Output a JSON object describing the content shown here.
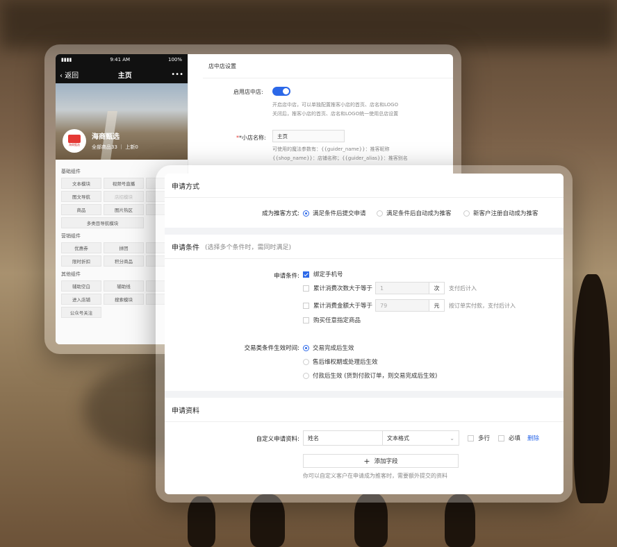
{
  "phone": {
    "signal": "▮▮▮▮",
    "time": "9:41 AM",
    "battery": "100%",
    "back_label": "返回",
    "title": "主页",
    "more": "•••",
    "shop_name": "海商甄选",
    "shop_logo_text": "海商甄选",
    "shop_stats": "全部商品33 ｜ 上新0"
  },
  "components": {
    "basic_title": "基础组件",
    "basic": [
      "文本模块",
      "视频号直播",
      "图文导航",
      "店招模块",
      "商品",
      "图片热区",
      "多类目导航模块"
    ],
    "marketing_title": "营销组件",
    "marketing": [
      "优惠券",
      "拼团",
      "限时折扣",
      "积分商品"
    ],
    "other_title": "其他组件",
    "other": [
      "辅助空白",
      "辅助线",
      "进入店铺",
      "搜索模块",
      "公众号关注"
    ]
  },
  "settings": {
    "header": "店中店设置",
    "enable_label": "启用店中店:",
    "enable_help_1": "开启店中店，可以单独配置推客小店的首页、店名和LOGO",
    "enable_help_2": "关闭后，推客小店的首页、店名和LOGO统一使用总店设置",
    "name_label": "*小店名称:",
    "name_value": "主页",
    "name_help_1": "可使用的魔法参数有：{{guider_name}}：推客昵称",
    "name_help_2": "{{shop_name}}：店铺名称；{{guider_alias}}：推客别名"
  },
  "apply_method": {
    "title": "申请方式",
    "label": "成为推客方式:",
    "options": [
      "满足条件后提交申请",
      "满足条件后自动成为推客",
      "新客户注册自动成为推客"
    ],
    "selected": 0
  },
  "apply_conditions": {
    "title": "申请条件",
    "hint": "(选择多个条件时，需同时满足)",
    "label": "申请条件:",
    "bind_phone": "绑定手机号",
    "times_label": "累计消费次数大于等于",
    "times_value": "1",
    "times_unit": "次",
    "times_note": "支付后计入",
    "amount_label": "累计消费金额大于等于",
    "amount_value": "79",
    "amount_unit": "元",
    "amount_note": "按订单实付款，支付后计入",
    "any_goods": "购买任意指定商品",
    "effect_label": "交易类条件生效时间:",
    "effect_options": [
      "交易完成后生效",
      "售后维权期或处理后生效",
      "付款后生效 (货到付款订单，则交易完成后生效)"
    ],
    "effect_selected": 0
  },
  "apply_info": {
    "title": "申请资料",
    "label": "自定义申请资料:",
    "field_name": "姓名",
    "field_type": "文本格式",
    "multi_line": "多行",
    "required": "必填",
    "delete": "删除",
    "add_field": "添加字段",
    "footer_note": "你可以自定义客户在申请成为推客时，需要额外提交的资料"
  }
}
